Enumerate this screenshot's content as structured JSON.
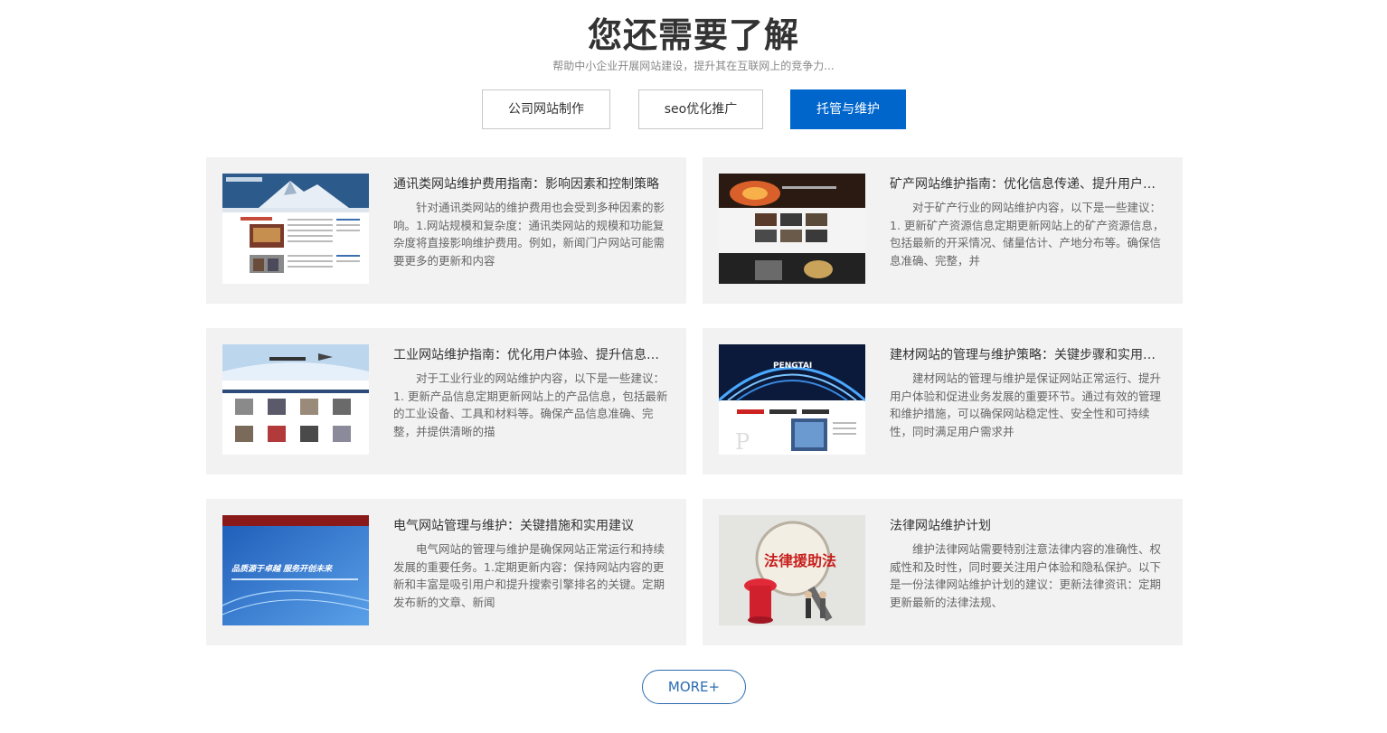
{
  "header": {
    "title": "您还需要了解",
    "subtitle": "帮助中小企业开展网站建设，提升其在互联网上的竞争力..."
  },
  "tabs": [
    {
      "label": "公司网站制作",
      "active": false
    },
    {
      "label": "seo优化推广",
      "active": false
    },
    {
      "label": "托管与维护",
      "active": true
    }
  ],
  "articles": [
    {
      "title": "通讯类网站维护费用指南：影响因素和控制策略",
      "desc": "针对通讯类网站的维护费用也会受到多种因素的影响。1.网站规模和复杂度：通讯类网站的规模和功能复杂度将直接影响维护费用。例如，新闻门户网站可能需要更多的更新和内容",
      "thumb": "mountain-website-screenshot"
    },
    {
      "title": "矿产网站维护指南：优化信息传递、提升用户体验",
      "desc": "对于矿产行业的网站维护内容，以下是一些建议：1. 更新矿产资源信息定期更新网站上的矿产资源信息，包括最新的开采情况、储量估计、产地分布等。确保信息准确、完整，并",
      "thumb": "mining-website-screenshot"
    },
    {
      "title": "工业网站维护指南：优化用户体验、提升信息传递",
      "desc": "对于工业行业的网站维护内容，以下是一些建议：1. 更新产品信息定期更新网站上的产品信息，包括最新的工业设备、工具和材料等。确保产品信息准确、完整，并提供清晰的描",
      "thumb": "industrial-website-screenshot"
    },
    {
      "title": "建材网站的管理与维护策略：关键步骤和实用建议",
      "desc": "建材网站的管理与维护是保证网站正常运行、提升用户体验和促进业务发展的重要环节。通过有效的管理和维护措施，可以确保网站稳定性、安全性和可持续性，同时满足用户需求并",
      "thumb": "building-materials-website-screenshot",
      "thumb_text": "PENGTAI"
    },
    {
      "title": "电气网站管理与维护：关键措施和实用建议",
      "desc": "电气网站的管理与维护是确保网站正常运行和持续发展的重要任务。1.定期更新内容：保持网站内容的更新和丰富是吸引用户和提升搜索引擎排名的关键。定期发布新的文章、新闻",
      "thumb": "electrical-website-screenshot",
      "thumb_text": "品质源于卓越 服务开创未来"
    },
    {
      "title": "法律网站维护计划",
      "desc": "维护法律网站需要特别注意法律内容的准确性、权威性和及时性，同时要关注用户体验和隐私保护。以下是一份法律网站维护计划的建议：更新法律资讯：定期更新最新的法律法规、",
      "thumb": "legal-aid-photo",
      "thumb_text": "法律援助法"
    }
  ],
  "more_label": "MORE+",
  "colors": {
    "accent": "#0066cc",
    "card_bg": "#f2f2f2"
  }
}
